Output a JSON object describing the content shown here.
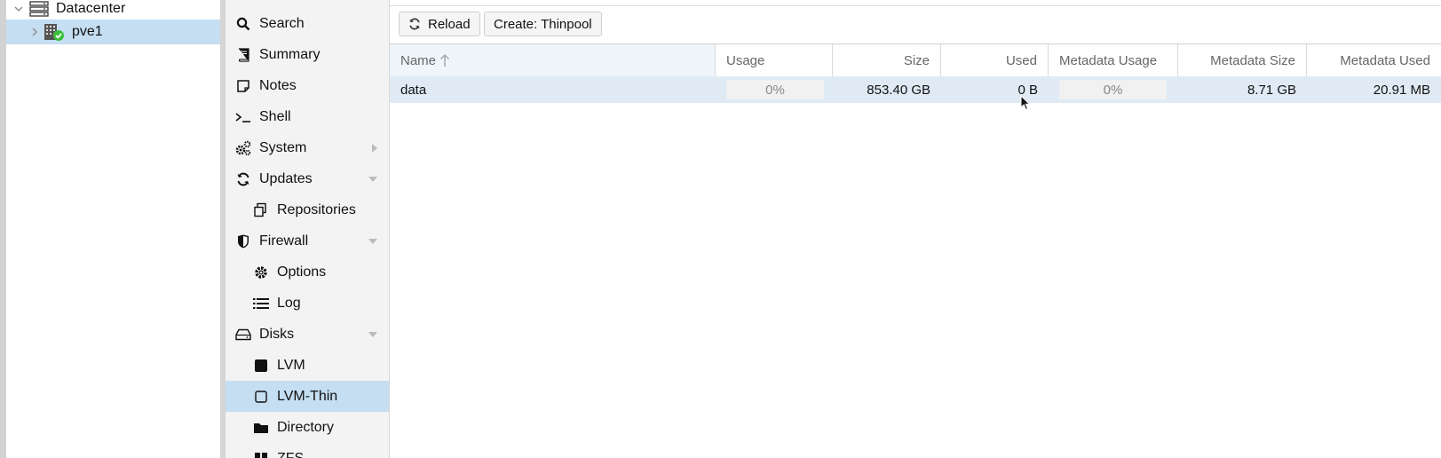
{
  "tree": {
    "datacenter_label": "Datacenter",
    "node_label": "pve1"
  },
  "nav": {
    "items": [
      {
        "label": "Search",
        "icon": "search-icon"
      },
      {
        "label": "Summary",
        "icon": "book-icon"
      },
      {
        "label": "Notes",
        "icon": "note-icon"
      },
      {
        "label": "Shell",
        "icon": "terminal-icon"
      },
      {
        "label": "System",
        "icon": "gears-icon"
      },
      {
        "label": "Updates",
        "icon": "refresh-icon"
      },
      {
        "label": "Repositories",
        "icon": "copy-icon"
      },
      {
        "label": "Firewall",
        "icon": "shield-icon"
      },
      {
        "label": "Options",
        "icon": "gear-icon"
      },
      {
        "label": "Log",
        "icon": "list-icon"
      },
      {
        "label": "Disks",
        "icon": "drive-icon"
      },
      {
        "label": "LVM",
        "icon": "square-filled-icon"
      },
      {
        "label": "LVM-Thin",
        "icon": "square-outline-icon"
      },
      {
        "label": "Directory",
        "icon": "folder-icon"
      },
      {
        "label": "ZFS",
        "icon": "grid-icon"
      }
    ],
    "selected": "LVM-Thin"
  },
  "toolbar": {
    "reload_label": "Reload",
    "create_label": "Create: Thinpool"
  },
  "grid": {
    "columns": [
      "Name",
      "Usage",
      "Size",
      "Used",
      "Metadata Usage",
      "Metadata Size",
      "Metadata Used"
    ],
    "rows": [
      {
        "name": "data",
        "usage": "0%",
        "size": "853.40 GB",
        "used": "0 B",
        "metadata_usage": "0%",
        "metadata_size": "8.71 GB",
        "metadata_used": "20.91 MB"
      }
    ]
  },
  "colors": {
    "selection": "#c5def2",
    "row_selected": "#dfeaf5",
    "nav_bg": "#f3f3f3",
    "status_ok": "#3bbf3b"
  }
}
